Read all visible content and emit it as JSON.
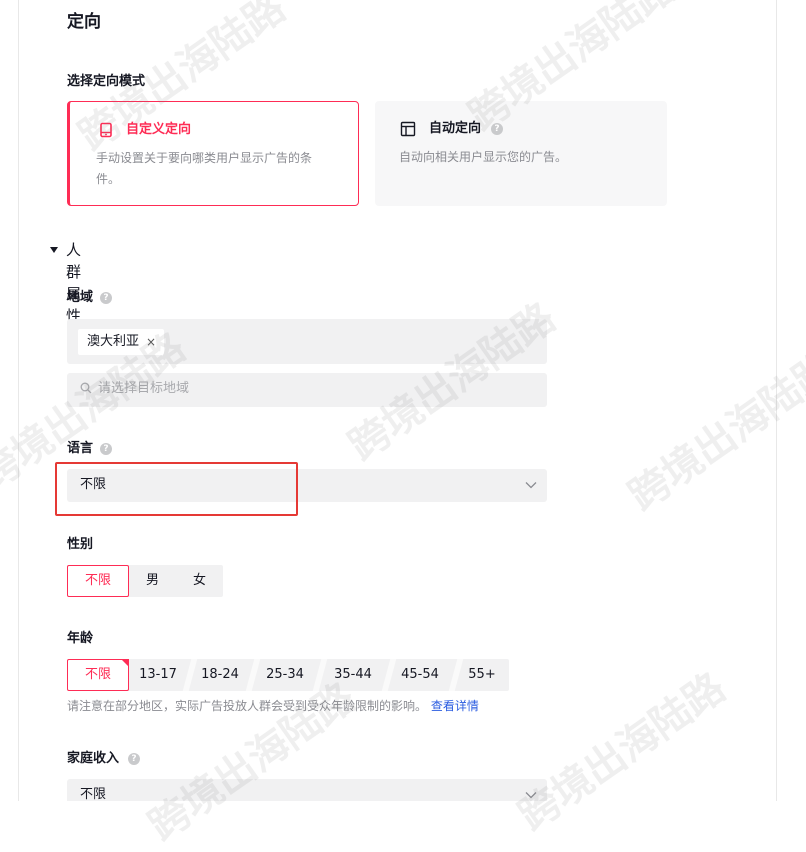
{
  "page": {
    "section_title": "定向",
    "mode_label": "选择定向模式",
    "modes": [
      {
        "title": "自定义定向",
        "description": "手动设置关于要向哪类用户显示广告的条件。",
        "selected": true,
        "icon": "mobile-icon"
      },
      {
        "title": "自动定向",
        "description": "自动向相关用户显示您的广告。",
        "selected": false,
        "icon": "layout-icon"
      }
    ],
    "demographics_label": "人群属性",
    "help_glyph": "?"
  },
  "location": {
    "label": "地域",
    "tags": [
      {
        "label": "澳大利亚",
        "close": "×"
      }
    ],
    "search_placeholder": "请选择目标地域"
  },
  "language": {
    "label": "语言",
    "value": "不限"
  },
  "gender": {
    "label": "性别",
    "options": [
      "不限",
      "男",
      "女"
    ],
    "selected": "不限"
  },
  "age": {
    "label": "年龄",
    "options": [
      "不限",
      "13-17",
      "18-24",
      "25-34",
      "35-44",
      "45-54",
      "55+"
    ],
    "selected": "不限",
    "note": "请注意在部分地区，实际广告投放人群会受到受众年龄限制的影响。",
    "note_link": "查看详情"
  },
  "income": {
    "label": "家庭收入",
    "value": "不限"
  },
  "watermark": "跨境出海陆路",
  "colors": {
    "accent": "#fe2c55",
    "highlight": "#e53935",
    "link": "#2b5ce0"
  }
}
